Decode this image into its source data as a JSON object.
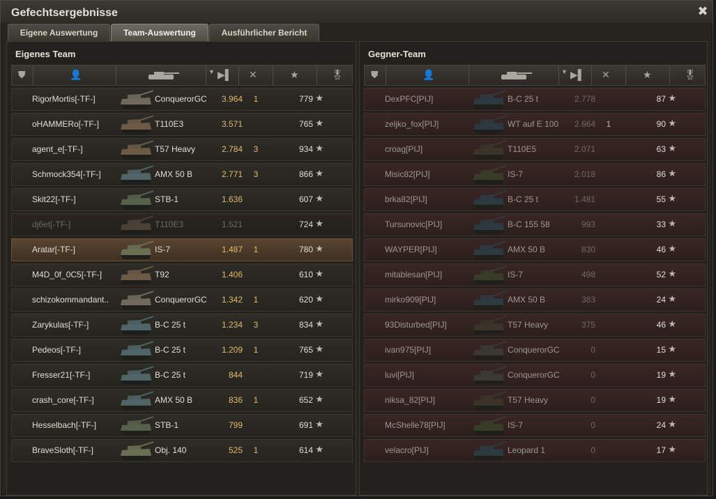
{
  "window": {
    "title": "Gefechtsergebnisse",
    "close_glyph": "✖"
  },
  "tabs": [
    {
      "label": "Eigene Auswertung"
    },
    {
      "label": "Team-Auswertung"
    },
    {
      "label": "Ausführlicher Bericht"
    }
  ],
  "active_tab": "Team-Auswertung",
  "star_glyph": "★",
  "own_team": {
    "title": "Eigenes Team",
    "rows": [
      {
        "player": "RigorMortis[-TF-]",
        "tank": "ConquerorGC",
        "damage": "3.964",
        "kills": "1",
        "xp": "779",
        "state": "normal",
        "tank_color": "#6f6a5c"
      },
      {
        "player": "oHAMMERo[-TF-]",
        "tank": "T110E3",
        "damage": "3.571",
        "kills": "",
        "xp": "765",
        "state": "normal",
        "tank_color": "#6b5a45"
      },
      {
        "player": "agent_e[-TF-]",
        "tank": "T57 Heavy",
        "damage": "2.784",
        "kills": "3",
        "xp": "934",
        "state": "normal",
        "tank_color": "#6b5a45"
      },
      {
        "player": "Schmock354[-TF-]",
        "tank": "AMX 50 B",
        "damage": "2.771",
        "kills": "3",
        "xp": "866",
        "state": "normal",
        "tank_color": "#4f6466"
      },
      {
        "player": "Skit22[-TF-]",
        "tank": "STB-1",
        "damage": "1.636",
        "kills": "",
        "xp": "607",
        "state": "normal",
        "tank_color": "#56604a"
      },
      {
        "player": "dj6et[-TF-]",
        "tank": "T110E3",
        "damage": "1.521",
        "kills": "",
        "xp": "724",
        "state": "dead",
        "tank_color": "#4a4038"
      },
      {
        "player": "Aratar[-TF-]",
        "tank": "IS-7",
        "damage": "1.487",
        "kills": "1",
        "xp": "780",
        "state": "me",
        "tank_color": "#6a6f52"
      },
      {
        "player": "M4D_0f_0C5[-TF-]",
        "tank": "T92",
        "damage": "1.406",
        "kills": "",
        "xp": "610",
        "state": "normal",
        "tank_color": "#6b5a45"
      },
      {
        "player": "schizokommandant..",
        "tank": "ConquerorGC",
        "damage": "1.342",
        "kills": "1",
        "xp": "620",
        "state": "normal",
        "tank_color": "#6f6a5c"
      },
      {
        "player": "Zarykulas[-TF-]",
        "tank": "B-C 25 t",
        "damage": "1.234",
        "kills": "3",
        "xp": "834",
        "state": "normal",
        "tank_color": "#4f6466"
      },
      {
        "player": "Pedeos[-TF-]",
        "tank": "B-C 25 t",
        "damage": "1.209",
        "kills": "1",
        "xp": "765",
        "state": "normal",
        "tank_color": "#4f6466"
      },
      {
        "player": "Fresser21[-TF-]",
        "tank": "B-C 25 t",
        "damage": "844",
        "kills": "",
        "xp": "719",
        "state": "normal",
        "tank_color": "#4f6466"
      },
      {
        "player": "crash_core[-TF-]",
        "tank": "AMX 50 B",
        "damage": "836",
        "kills": "1",
        "xp": "652",
        "state": "normal",
        "tank_color": "#4f6466"
      },
      {
        "player": "Hesselbach[-TF-]",
        "tank": "STB-1",
        "damage": "799",
        "kills": "",
        "xp": "691",
        "state": "normal",
        "tank_color": "#56604a"
      },
      {
        "player": "BraveSloth[-TF-]",
        "tank": "Obj. 140",
        "damage": "525",
        "kills": "1",
        "xp": "614",
        "state": "normal",
        "tank_color": "#6a6f52"
      }
    ]
  },
  "enemy_team": {
    "title": "Gegner-Team",
    "rows": [
      {
        "player": "DexPFC[PIJ]",
        "tank": "B-C 25 t",
        "damage": "2.778",
        "kills": "",
        "xp": "87",
        "tank_color": "#2c3a40"
      },
      {
        "player": "zeljko_fox[PIJ]",
        "tank": "WT auf E 100",
        "damage": "2.664",
        "kills": "1",
        "xp": "90",
        "tank_color": "#2c3a40"
      },
      {
        "player": "croag[PIJ]",
        "tank": "T110E5",
        "damage": "2.071",
        "kills": "",
        "xp": "63",
        "tank_color": "#3a3528"
      },
      {
        "player": "Misic82[PIJ]",
        "tank": "IS-7",
        "damage": "2.018",
        "kills": "",
        "xp": "86",
        "tank_color": "#383d2a"
      },
      {
        "player": "brka82[PIJ]",
        "tank": "B-C 25 t",
        "damage": "1.481",
        "kills": "",
        "xp": "55",
        "tank_color": "#2c3a40"
      },
      {
        "player": "Tursunovic[PIJ]",
        "tank": "B-C 155 58",
        "damage": "993",
        "kills": "",
        "xp": "33",
        "tank_color": "#2c3a40"
      },
      {
        "player": "WAYPER[PIJ]",
        "tank": "AMX 50 B",
        "damage": "830",
        "kills": "",
        "xp": "46",
        "tank_color": "#2c3a40"
      },
      {
        "player": "mitablesan[PIJ]",
        "tank": "IS-7",
        "damage": "498",
        "kills": "",
        "xp": "52",
        "tank_color": "#383d2a"
      },
      {
        "player": "mirko909[PIJ]",
        "tank": "AMX 50 B",
        "damage": "383",
        "kills": "",
        "xp": "24",
        "tank_color": "#2c3a40"
      },
      {
        "player": "93Disturbed[PIJ]",
        "tank": "T57 Heavy",
        "damage": "375",
        "kills": "",
        "xp": "46",
        "tank_color": "#3a3528"
      },
      {
        "player": "ivan975[PIJ]",
        "tank": "ConquerorGC",
        "damage": "0",
        "kills": "",
        "xp": "15",
        "tank_color": "#3b3833"
      },
      {
        "player": "luvi[PIJ]",
        "tank": "ConquerorGC",
        "damage": "0",
        "kills": "",
        "xp": "19",
        "tank_color": "#3b3833"
      },
      {
        "player": "niksa_82[PIJ]",
        "tank": "T57 Heavy",
        "damage": "0",
        "kills": "",
        "xp": "19",
        "tank_color": "#3a3528"
      },
      {
        "player": "McShelle78[PIJ]",
        "tank": "IS-7",
        "damage": "0",
        "kills": "",
        "xp": "24",
        "tank_color": "#383d2a"
      },
      {
        "player": "velacro[PIJ]",
        "tank": "Leopard 1",
        "damage": "0",
        "kills": "",
        "xp": "17",
        "tank_color": "#2c3a40"
      }
    ]
  }
}
